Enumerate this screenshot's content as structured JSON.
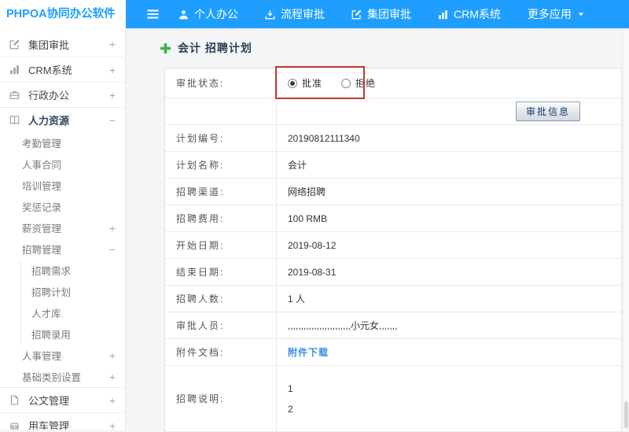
{
  "colors": {
    "header_blue": "#1e9fff",
    "annotation_red": "#c0392b",
    "link_blue": "#3a8ee6",
    "plus_green": "#3fae49"
  },
  "header": {
    "logo": "PHPOA协同办公软件",
    "nav": [
      {
        "name": "nav-personal-office",
        "label": "个人办公",
        "icon": "person-icon"
      },
      {
        "name": "nav-workflow-approval",
        "label": "流程审批",
        "icon": "workflow-icon"
      },
      {
        "name": "nav-group-approval",
        "label": "集团审批",
        "icon": "edit-square-icon"
      },
      {
        "name": "nav-crm-system",
        "label": "CRM系统",
        "icon": "bar-chart-icon"
      },
      {
        "name": "nav-more-apps",
        "label": "更多应用",
        "icon": "caret-down-icon",
        "icon_position": "right"
      }
    ]
  },
  "sidebar": {
    "items": [
      {
        "name": "sidebar-item-group-approval",
        "label": "集团审批",
        "icon": "edit-square-icon",
        "expander": "+",
        "level": 0
      },
      {
        "name": "sidebar-item-crm",
        "label": "CRM系统",
        "icon": "bar-chart-icon",
        "expander": "+",
        "level": 0
      },
      {
        "name": "sidebar-item-admin-office",
        "label": "行政办公",
        "icon": "briefcase-icon",
        "expander": "+",
        "level": 0
      },
      {
        "name": "sidebar-item-hr",
        "label": "人力资源",
        "icon": "book-icon",
        "expander": "−",
        "level": 0,
        "expanded": true
      },
      {
        "name": "sidebar-item-attendance",
        "label": "考勤管理",
        "level": 1
      },
      {
        "name": "sidebar-item-contract",
        "label": "人事合同",
        "level": 1
      },
      {
        "name": "sidebar-item-training",
        "label": "培训管理",
        "level": 1
      },
      {
        "name": "sidebar-item-rewards",
        "label": "奖惩记录",
        "level": 1
      },
      {
        "name": "sidebar-item-salary",
        "label": "薪资管理",
        "expander": "+",
        "level": 1
      },
      {
        "name": "sidebar-item-recruit",
        "label": "招聘管理",
        "expander": "−",
        "level": 1,
        "expanded": true
      },
      {
        "name": "sidebar-item-recruit-demand",
        "label": "招聘需求",
        "level": 2
      },
      {
        "name": "sidebar-item-recruit-plan",
        "label": "招聘计划",
        "level": 2
      },
      {
        "name": "sidebar-item-talent-pool",
        "label": "人才库",
        "level": 2
      },
      {
        "name": "sidebar-item-recruit-hire",
        "label": "招聘录用",
        "level": 2
      },
      {
        "name": "sidebar-item-personnel",
        "label": "人事管理",
        "expander": "+",
        "level": 1
      },
      {
        "name": "sidebar-item-base-category",
        "label": "基础类别设置",
        "expander": "+",
        "level": 1
      },
      {
        "name": "sidebar-item-document",
        "label": "公文管理",
        "icon": "document-icon",
        "expander": "+",
        "level": 0
      },
      {
        "name": "sidebar-item-vehicle",
        "label": "用车管理",
        "icon": "car-icon",
        "expander": "+",
        "level": 0
      }
    ]
  },
  "main": {
    "title": "会计 招聘计划",
    "status": {
      "label": "审批状态:",
      "options": [
        {
          "label": "批准",
          "selected": true
        },
        {
          "label": "拒绝",
          "selected": false
        }
      ]
    },
    "approve_info_button": "审批信息",
    "rows": [
      {
        "label": "计划编号:",
        "value": "20190812111340"
      },
      {
        "label": "计划名称:",
        "value": "会计"
      },
      {
        "label": "招聘渠道:",
        "value": "网络招聘"
      },
      {
        "label": "招聘费用:",
        "value": "100 RMB"
      },
      {
        "label": "开始日期:",
        "value": "2019-08-12"
      },
      {
        "label": "结束日期:",
        "value": "2019-08-31"
      },
      {
        "label": "招聘人数:",
        "value": "1 人"
      },
      {
        "label": "审批人员:",
        "value": ",,,,,,,,,,,,,,,,,,,,,,,,小元女,,,,,,,"
      },
      {
        "label": "附件文档:",
        "value": "附件下载",
        "link": true
      },
      {
        "label": "招聘说明:",
        "lines": [
          "1",
          "2"
        ]
      }
    ]
  }
}
